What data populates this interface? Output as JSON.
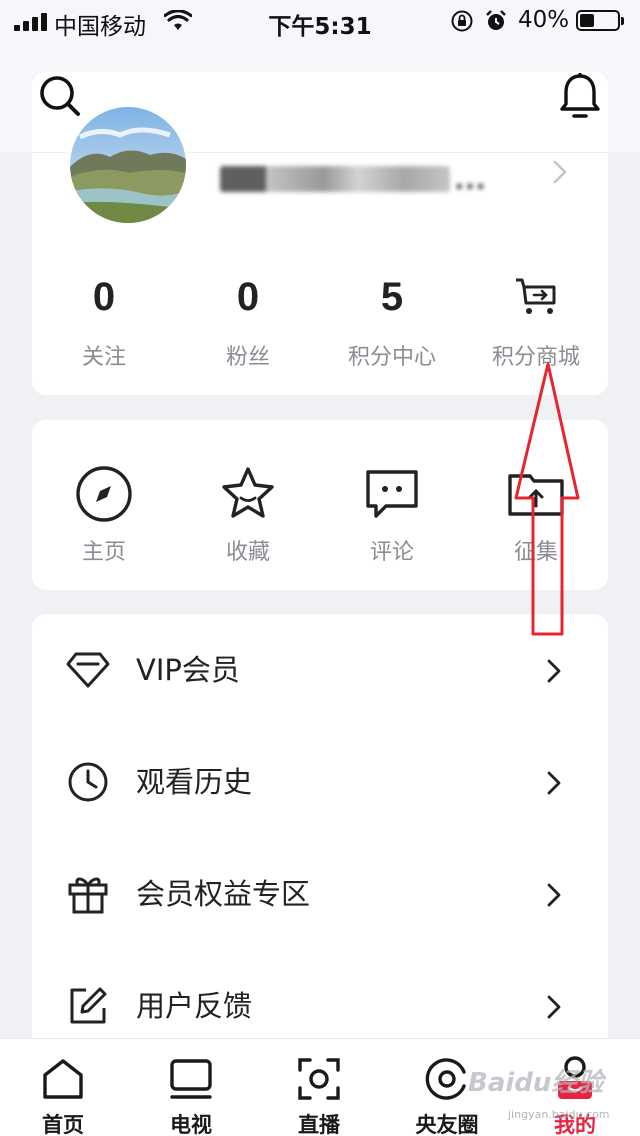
{
  "status_bar": {
    "carrier": "中国移动",
    "time": "下午5:31",
    "battery_percent": "40%",
    "battery_level": 0.4
  },
  "profile": {
    "username": "..."
  },
  "stats": [
    {
      "value": "0",
      "label": "关注"
    },
    {
      "value": "0",
      "label": "粉丝"
    },
    {
      "value": "5",
      "label": "积分中心"
    },
    {
      "label": "积分商城",
      "icon": "shopping-cart-icon"
    }
  ],
  "actions": [
    {
      "label": "主页",
      "icon": "compass-icon"
    },
    {
      "label": "收藏",
      "icon": "star-icon"
    },
    {
      "label": "评论",
      "icon": "comment-icon"
    },
    {
      "label": "征集",
      "icon": "upload-folder-icon"
    }
  ],
  "menu": [
    {
      "label": "VIP会员",
      "icon": "diamond-icon"
    },
    {
      "label": "观看历史",
      "icon": "clock-icon"
    },
    {
      "label": "会员权益专区",
      "icon": "gift-icon"
    },
    {
      "label": "用户反馈",
      "icon": "edit-icon"
    }
  ],
  "tabs": [
    {
      "label": "首页",
      "icon": "home-icon",
      "active": false
    },
    {
      "label": "电视",
      "icon": "tv-icon",
      "active": false
    },
    {
      "label": "直播",
      "icon": "live-icon",
      "active": false
    },
    {
      "label": "央友圈",
      "icon": "community-icon",
      "active": false
    },
    {
      "label": "我的",
      "icon": "profile-icon",
      "active": true
    }
  ],
  "watermark": {
    "text": "Baidu经验",
    "sub": "jingyan.baidu.com"
  },
  "colors": {
    "accent": "#e5243f",
    "annotation": "#e8242e",
    "background": "#eff1f5"
  }
}
